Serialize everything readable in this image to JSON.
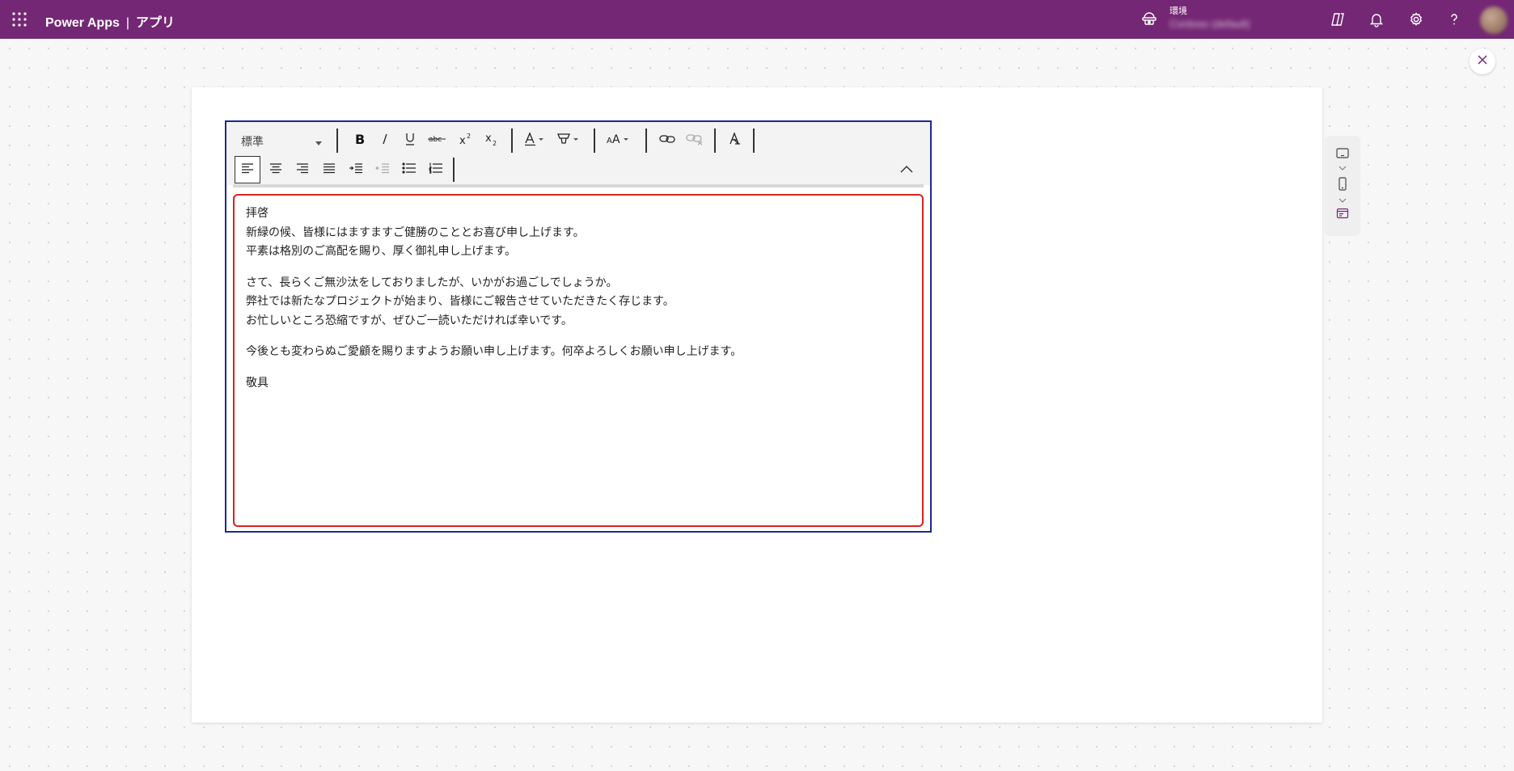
{
  "header": {
    "app_name": "Power Apps",
    "divider": "|",
    "section": "アプリ",
    "environment_label": "環境",
    "environment_name": "Contoso (default)"
  },
  "colors": {
    "brand": "#742774",
    "editor_frame": "#1c2a8c",
    "editor_focus": "#e02020"
  },
  "toolbar": {
    "font_style": "標準",
    "row1_icons": [
      "bold-icon",
      "italic-icon",
      "underline-icon",
      "strikethrough-icon",
      "superscript-icon",
      "subscript-icon",
      "font-color-icon",
      "highlight-icon",
      "font-size-icon",
      "link-icon",
      "unlink-icon",
      "clear-formatting-icon"
    ],
    "row2_icons": [
      "align-left-icon",
      "align-center-icon",
      "align-right-icon",
      "justify-icon",
      "indent-icon",
      "outdent-icon",
      "bullet-list-icon",
      "numbered-list-icon",
      "collapse-toolbar-icon"
    ]
  },
  "editor": {
    "paragraphs": [
      {
        "lines": [
          "拝啓",
          "新緑の候、皆様にはますますご健勝のこととお喜び申し上げます。",
          "平素は格別のご高配を賜り、厚く御礼申し上げます。"
        ]
      },
      {
        "lines": [
          "さて、長らくご無沙汰をしておりましたが、いかがお過ごしでしょうか。",
          "弊社では新たなプロジェクトが始まり、皆様にご報告させていただきたく存じます。",
          "お忙しいところ恐縮ですが、ぜひご一読いただければ幸いです。"
        ]
      },
      {
        "lines": [
          "今後とも変わらぬご愛顧を賜りますようお願い申し上げます。何卒よろしくお願い申し上げます。"
        ]
      },
      {
        "lines": [
          "敬具"
        ]
      }
    ]
  },
  "device_panel": {
    "icons": [
      "tablet-icon",
      "phone-icon",
      "web-icon"
    ]
  }
}
